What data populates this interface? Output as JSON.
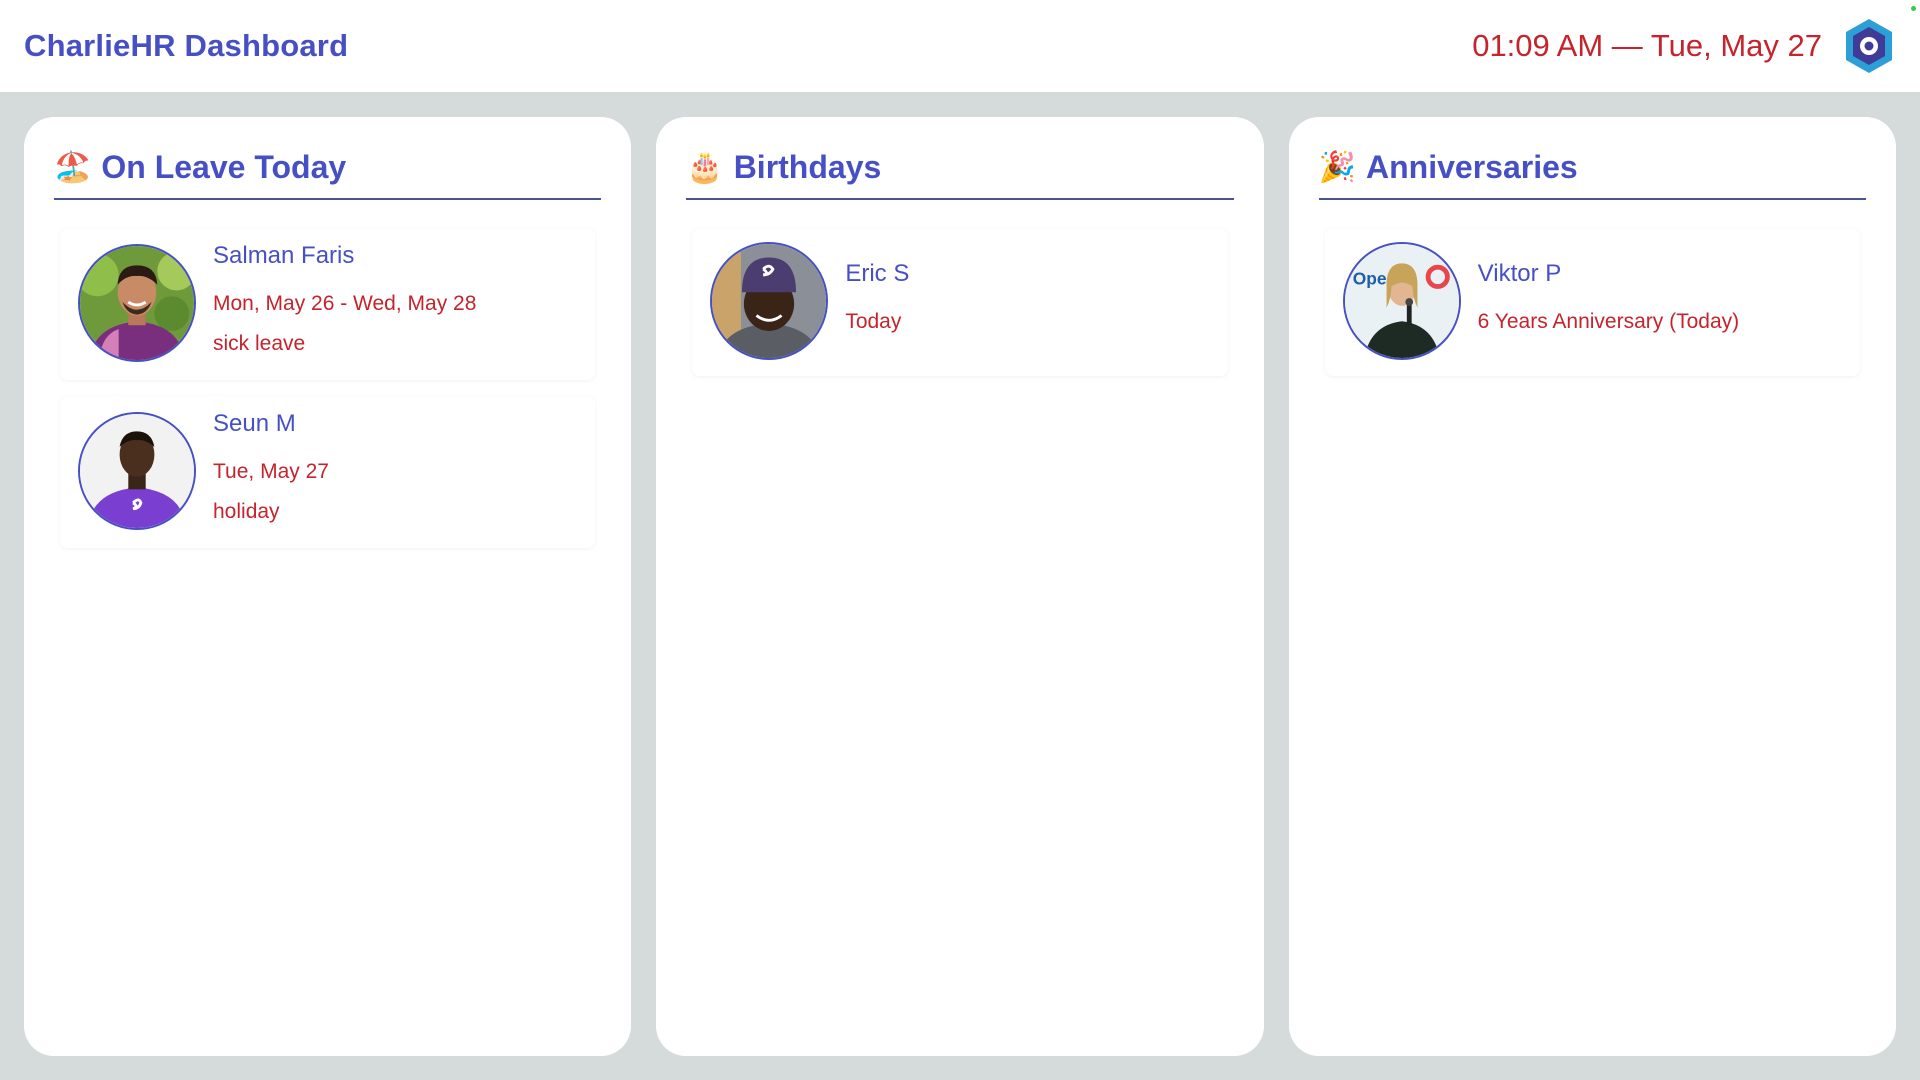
{
  "header": {
    "title": "CharlieHR Dashboard",
    "datetime": "01:09 AM — Tue, May 27",
    "logo_icon": "hexagon-logo-icon"
  },
  "colors": {
    "accent": "#4650c4",
    "highlight": "#c5242d",
    "background": "#d5dada"
  },
  "on_leave": {
    "emoji": "🏖️",
    "title": "On Leave Today",
    "people": [
      {
        "name": "Salman Faris",
        "dates": "Mon, May 26 - Wed, May 28",
        "type": "sick leave"
      },
      {
        "name": "Seun M",
        "dates": "Tue, May 27",
        "type": "holiday"
      }
    ]
  },
  "birthdays": {
    "emoji": "🎂",
    "title": "Birthdays",
    "people": [
      {
        "name": "Eric S",
        "detail": "Today"
      }
    ]
  },
  "anniversaries": {
    "emoji": "🎉",
    "title": "Anniversaries",
    "people": [
      {
        "name": "Viktor P",
        "detail": "6 Years Anniversary (Today)",
        "photo_sign": "Ope"
      }
    ]
  }
}
